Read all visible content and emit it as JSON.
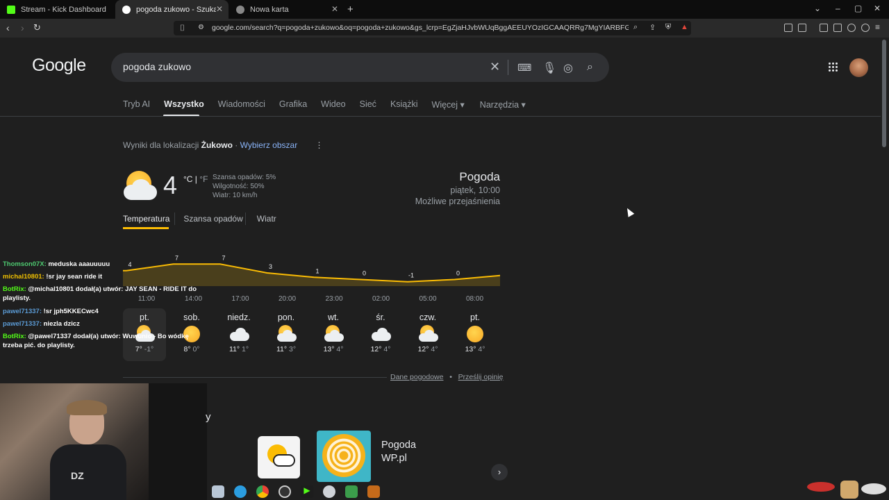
{
  "tabs": [
    {
      "title": "Stream - Kick Dashboard",
      "color": "#53fc18"
    },
    {
      "title": "pogoda zukowo - Szukaj w Goo",
      "color": "#e8eaed"
    },
    {
      "title": "Nowa karta",
      "color": "#cfcfcf"
    }
  ],
  "toolbar": {
    "url": "google.com/search?q=pogoda+zukowo&oq=pogoda+zukowo&gs_lcrp=EgZjaHJvbWUqBggAEEUYOzIGCAAQRRg7MgYIARBFGDsyBggCEC4YQ..."
  },
  "google": {
    "logo": "Google",
    "query": "pogoda zukowo",
    "nav_tabs": [
      "Tryb AI",
      "Wszystko",
      "Wiadomości",
      "Grafika",
      "Wideo",
      "Sieć",
      "Książki",
      "Więcej ▾",
      "Narzędzia ▾"
    ],
    "location_prefix": "Wyniki dla lokalizacji",
    "location": "Żukowo",
    "location_link": "Wybierz obszar"
  },
  "weather": {
    "temp": "4",
    "unit_c": "°C",
    "unit_f": "°F",
    "rain_chance": "Szansa opadów: 5%",
    "humidity": "Wilgotność: 50%",
    "wind": "Wiatr: 10 km/h",
    "title": "Pogoda",
    "time": "piątek, 10:00",
    "condition": "Możliwe przejaśnienia",
    "tabs": [
      "Temperatura",
      "Szansa opadów",
      "Wiatr"
    ],
    "days": [
      {
        "name": "pt.",
        "hi": "7°",
        "lo": "-1°",
        "icon": "partly-cloudy-icon"
      },
      {
        "name": "sob.",
        "hi": "8°",
        "lo": "0°",
        "icon": "sunny-icon"
      },
      {
        "name": "niedz.",
        "hi": "11°",
        "lo": "1°",
        "icon": "cloudy-icon"
      },
      {
        "name": "pon.",
        "hi": "11°",
        "lo": "3°",
        "icon": "partly-cloudy-icon"
      },
      {
        "name": "wt.",
        "hi": "13°",
        "lo": "4°",
        "icon": "partly-cloudy-icon"
      },
      {
        "name": "śr.",
        "hi": "12°",
        "lo": "4°",
        "icon": "cloudy-icon"
      },
      {
        "name": "czw.",
        "hi": "12°",
        "lo": "4°",
        "icon": "partly-cloudy-icon"
      },
      {
        "name": "pt.",
        "hi": "13°",
        "lo": "4°",
        "icon": "sunny-icon"
      }
    ],
    "footer_links": [
      "Dane pogodowe",
      "Prześlij opinię"
    ]
  },
  "chart_data": {
    "type": "area",
    "categories": [
      "11:00",
      "14:00",
      "17:00",
      "20:00",
      "23:00",
      "02:00",
      "05:00",
      "08:00"
    ],
    "values": [
      4,
      7,
      7,
      3,
      1,
      0,
      -1,
      0
    ],
    "ylim": [
      -3,
      9
    ],
    "grid": false,
    "color": "#fbbc04"
  },
  "chat": [
    {
      "user": "Thomson07X:",
      "text": "meduska aaauuuuu",
      "color": "#4ecb71"
    },
    {
      "user": "michal10801:",
      "text": "!sr jay sean ride it",
      "color": "#f0c000"
    },
    {
      "user": "BotRix:",
      "text": "@michal10801 dodał(a) utwór: JAY SEAN - RIDE IT do playlisty.",
      "color": "#53fc18"
    },
    {
      "user": "pawel71337:",
      "text": "!sr jph5KKECwc4",
      "color": "#5b9bd5"
    },
    {
      "user": "pawel71337:",
      "text": "niezla dzicz",
      "color": "#5b9bd5"
    },
    {
      "user": "BotRix:",
      "text": "@pawel71337 dodał(a) utwór: Wuwunio - Bo wódkę trzeba pić. do playlisty.",
      "color": "#53fc18"
    }
  ],
  "results": {
    "app_title_line1": "Pogoda",
    "app_title_line2": "WP.pl"
  }
}
